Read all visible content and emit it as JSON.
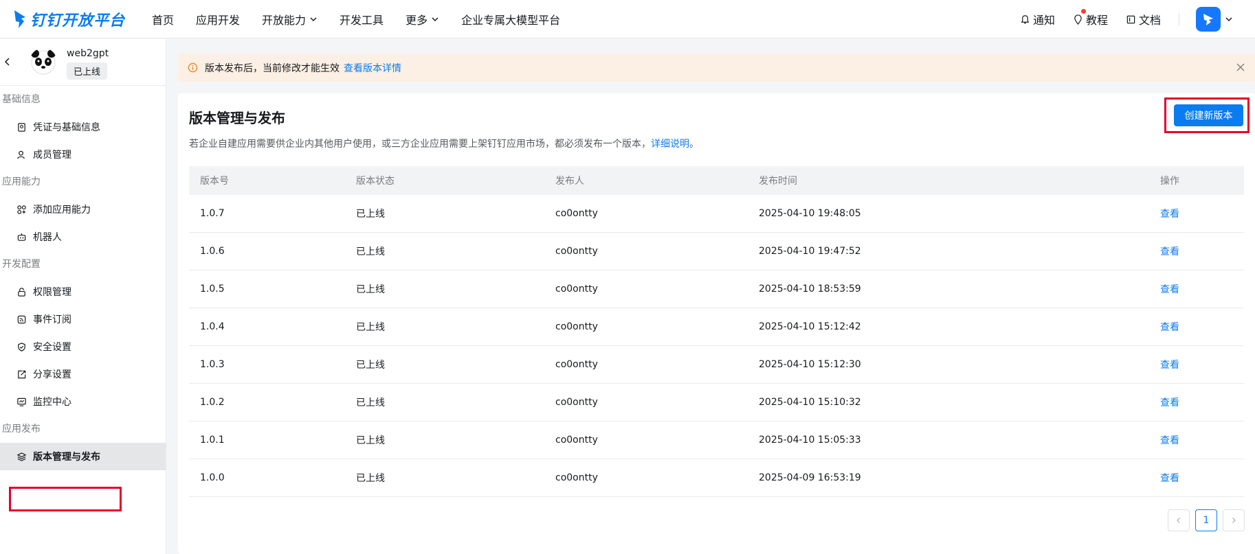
{
  "brand": {
    "name": "钉钉开放平台"
  },
  "nav": {
    "items": [
      {
        "label": "首页",
        "has_dropdown": false
      },
      {
        "label": "应用开发",
        "has_dropdown": false
      },
      {
        "label": "开放能力",
        "has_dropdown": true
      },
      {
        "label": "开发工具",
        "has_dropdown": false
      },
      {
        "label": "更多",
        "has_dropdown": true
      },
      {
        "label": "企业专属大模型平台",
        "has_dropdown": false
      }
    ]
  },
  "tools": {
    "notify": "通知",
    "tutorial": "教程",
    "docs": "文档"
  },
  "app": {
    "name": "web2gpt",
    "status": "已上线"
  },
  "sidebar": {
    "groups": [
      {
        "title": "基础信息",
        "items": [
          {
            "label": "凭证与基础信息",
            "icon": "credential-icon"
          },
          {
            "label": "成员管理",
            "icon": "member-icon"
          }
        ]
      },
      {
        "title": "应用能力",
        "items": [
          {
            "label": "添加应用能力",
            "icon": "add-capability-icon"
          },
          {
            "label": "机器人",
            "icon": "robot-icon"
          }
        ]
      },
      {
        "title": "开发配置",
        "items": [
          {
            "label": "权限管理",
            "icon": "lock-icon"
          },
          {
            "label": "事件订阅",
            "icon": "subscribe-icon"
          },
          {
            "label": "安全设置",
            "icon": "shield-icon"
          },
          {
            "label": "分享设置",
            "icon": "share-icon"
          },
          {
            "label": "监控中心",
            "icon": "monitor-icon"
          }
        ]
      },
      {
        "title": "应用发布",
        "items": [
          {
            "label": "版本管理与发布",
            "icon": "layers-icon"
          }
        ]
      }
    ]
  },
  "alert": {
    "text": "版本发布后，当前修改才能生效",
    "link": "查看版本详情"
  },
  "page": {
    "title": "版本管理与发布",
    "desc": "若企业自建应用需要供企业内其他用户使用，或三方企业应用需要上架钉钉应用市场，都必须发布一个版本，",
    "desc_link": "详细说明",
    "desc_end": "。",
    "create_button": "创建新版本"
  },
  "table": {
    "headers": [
      "版本号",
      "版本状态",
      "发布人",
      "发布时间",
      "操作"
    ],
    "rows": [
      {
        "version": "1.0.7",
        "status": "已上线",
        "publisher": "co0ontty",
        "time": "2025-04-10 19:48:05",
        "action": "查看"
      },
      {
        "version": "1.0.6",
        "status": "已上线",
        "publisher": "co0ontty",
        "time": "2025-04-10 19:47:52",
        "action": "查看"
      },
      {
        "version": "1.0.5",
        "status": "已上线",
        "publisher": "co0ontty",
        "time": "2025-04-10 18:53:59",
        "action": "查看"
      },
      {
        "version": "1.0.4",
        "status": "已上线",
        "publisher": "co0ontty",
        "time": "2025-04-10 15:12:42",
        "action": "查看"
      },
      {
        "version": "1.0.3",
        "status": "已上线",
        "publisher": "co0ontty",
        "time": "2025-04-10 15:12:30",
        "action": "查看"
      },
      {
        "version": "1.0.2",
        "status": "已上线",
        "publisher": "co0ontty",
        "time": "2025-04-10 15:10:32",
        "action": "查看"
      },
      {
        "version": "1.0.1",
        "status": "已上线",
        "publisher": "co0ontty",
        "time": "2025-04-10 15:05:33",
        "action": "查看"
      },
      {
        "version": "1.0.0",
        "status": "已上线",
        "publisher": "co0ontty",
        "time": "2025-04-09 16:53:19",
        "action": "查看"
      }
    ]
  },
  "pagination": {
    "current": "1"
  },
  "colors": {
    "accent": "#0b7cf0",
    "highlight": "#e4002b",
    "alert_bg": "#fcefe4"
  }
}
